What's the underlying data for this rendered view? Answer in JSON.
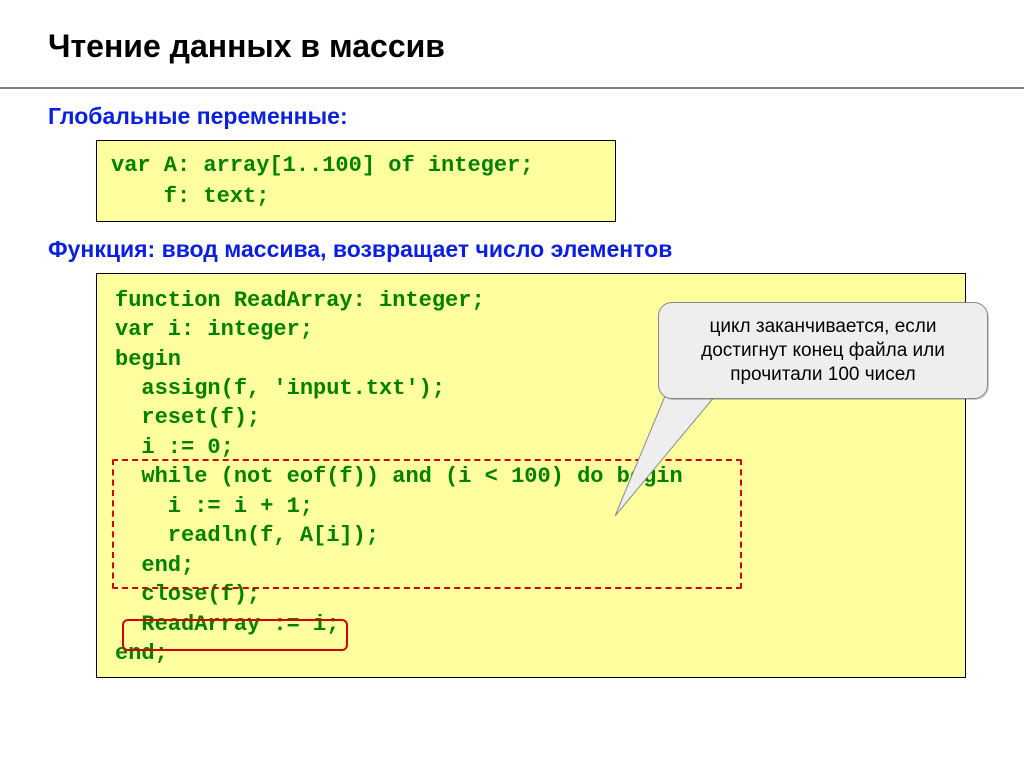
{
  "title": "Чтение данных в массив",
  "sec1_heading": "Глобальные переменные:",
  "code1": "var A: array[1..100] of integer;\n    f: text;",
  "sec2_heading": "Функция: ввод массива, возвращает число элементов",
  "code2": "function ReadArray: integer;\nvar i: integer;\nbegin\n  assign(f, 'input.txt');\n  reset(f);\n  i := 0;\n  while (not eof(f)) and (i < 100) do begin\n    i := i + 1;\n    readln(f, A[i]);\n  end;\n  close(f);\n  ReadArray := i;\nend;",
  "callout": "цикл заканчивается, если достигнут конец файла или прочитали 100 чисел"
}
